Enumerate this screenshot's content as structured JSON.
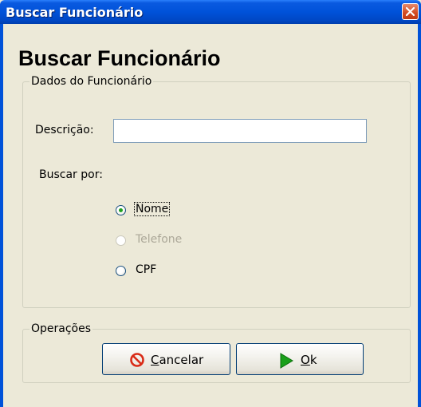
{
  "window": {
    "title": "Buscar Funcionário",
    "close_icon": "close-icon"
  },
  "heading": "Buscar Funcionário",
  "dados_group": {
    "title": "Dados do Funcionário",
    "descricao_label": "Descrição:",
    "descricao_value": "",
    "buscar_por_label": "Buscar por:",
    "options": [
      {
        "label": "Nome",
        "checked": true,
        "enabled": true
      },
      {
        "label": "Telefone",
        "checked": false,
        "enabled": false
      },
      {
        "label": "CPF",
        "checked": false,
        "enabled": true
      }
    ]
  },
  "operacoes_group": {
    "title": "Operações",
    "cancel_label": "Cancelar",
    "cancel_icon": "stop-icon",
    "cancel_icon_color": "#d92b17",
    "ok_label": "Ok",
    "ok_icon": "play-arrow-icon",
    "ok_icon_color": "#1aa01a"
  },
  "colors": {
    "titlebar": "#0052d9",
    "window_bg": "#ece9d8",
    "radio_checked": "#21a121"
  }
}
